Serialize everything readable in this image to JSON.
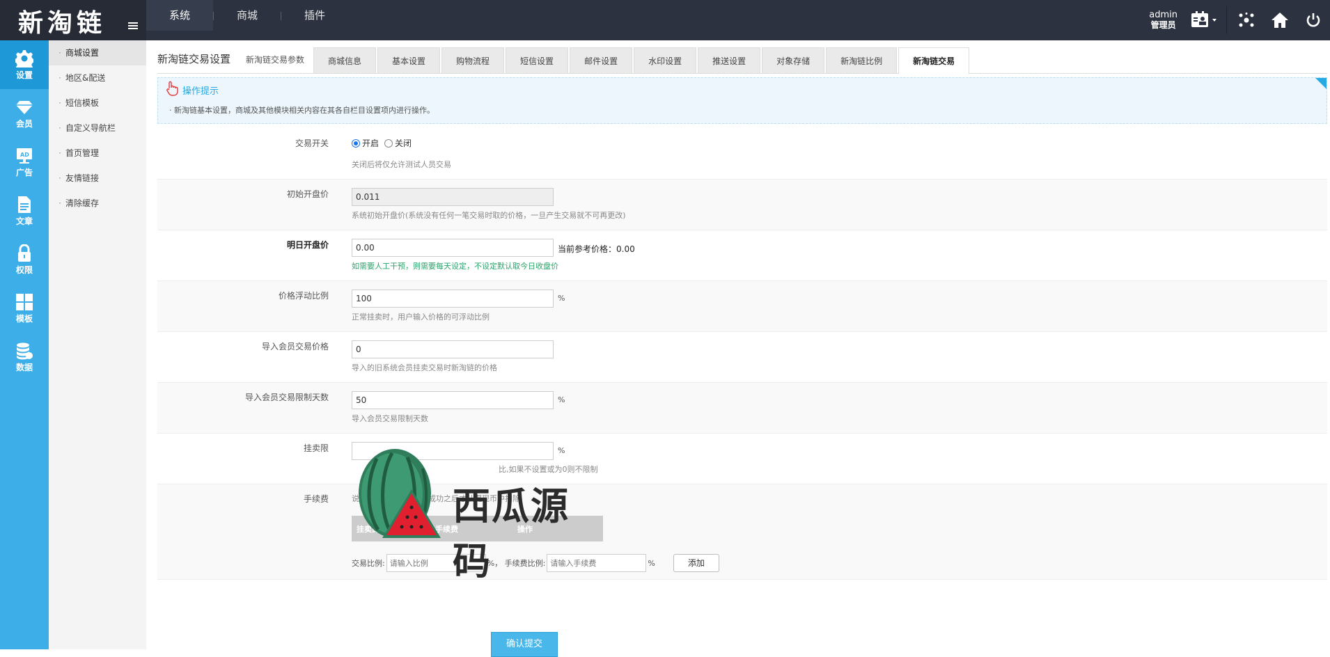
{
  "topbar": {
    "logo": "新淘链",
    "nav": [
      "系统",
      "商城",
      "插件"
    ],
    "admin_name": "admin",
    "admin_role": "管理员"
  },
  "iconbar": [
    {
      "label": "设置",
      "icon": "gear-icon"
    },
    {
      "label": "会员",
      "icon": "diamond-icon"
    },
    {
      "label": "广告",
      "icon": "ad-icon"
    },
    {
      "label": "文章",
      "icon": "document-icon"
    },
    {
      "label": "权限",
      "icon": "lock-icon"
    },
    {
      "label": "模板",
      "icon": "grid-icon"
    },
    {
      "label": "数据",
      "icon": "database-icon"
    }
  ],
  "sidebar": [
    "商城设置",
    "地区&配送",
    "短信模板",
    "自定义导航栏",
    "首页管理",
    "友情链接",
    "清除缓存"
  ],
  "page": {
    "title": "新淘链交易设置",
    "subtitle": "新淘链交易参数",
    "tabs": [
      "商城信息",
      "基本设置",
      "购物流程",
      "短信设置",
      "邮件设置",
      "水印设置",
      "推送设置",
      "对象存储",
      "新淘链比例",
      "新淘链交易"
    ]
  },
  "tip": {
    "title": "操作提示",
    "text": "新淘链基本设置，商城及其他模块相关内容在其各自栏目设置项内进行操作。"
  },
  "form": {
    "switch": {
      "label": "交易开关",
      "on": "开启",
      "off": "关闭",
      "hint": "关闭后将仅允许测试人员交易"
    },
    "initial_price": {
      "label": "初始开盘价",
      "value": "0.011",
      "hint": "系统初始开盘价(系统没有任何一笔交易时取的价格，一旦产生交易就不可再更改)"
    },
    "tomorrow_price": {
      "label": "明日开盘价",
      "value": "0.00",
      "ref": "当前参考价格：0.00",
      "hint": "如需要人工干预，则需要每天设定，不设定默认取今日收盘价"
    },
    "float_ratio": {
      "label": "价格浮动比例",
      "value": "100",
      "unit": "%",
      "hint": "正常挂卖时，用户输入价格的可浮动比例"
    },
    "import_price": {
      "label": "导入会员交易价格",
      "value": "0",
      "hint": "导入的旧系统会员挂卖交易时新淘链的价格"
    },
    "import_days": {
      "label": "导入会员交易限制天数",
      "value": "50",
      "unit": "%",
      "hint": "导入会员交易限制天数"
    },
    "sell_limit": {
      "label": "挂卖限",
      "value": "",
      "unit": "%",
      "hint": "比,如果不设置或为0则不限制"
    },
    "fee": {
      "label": "手续费",
      "hint": "说明：手续费是在交易成功之后才从提现币中扣除",
      "columns": [
        "挂卖比例(大于等于)",
        "手续费",
        "操作"
      ],
      "ratio_label": "交易比例:",
      "ratio_placeholder": "请输入比例",
      "fee_label": "%， 手续费比例:",
      "fee_placeholder": "请输入手续费",
      "unit": "%",
      "add": "添加"
    },
    "submit": "确认提交"
  },
  "watermark": "西瓜源码",
  "colors": {
    "topbar": "#2c323f",
    "iconbar": "#3eaee8",
    "accent": "#27a9e3",
    "submit": "#4ab7ea"
  }
}
